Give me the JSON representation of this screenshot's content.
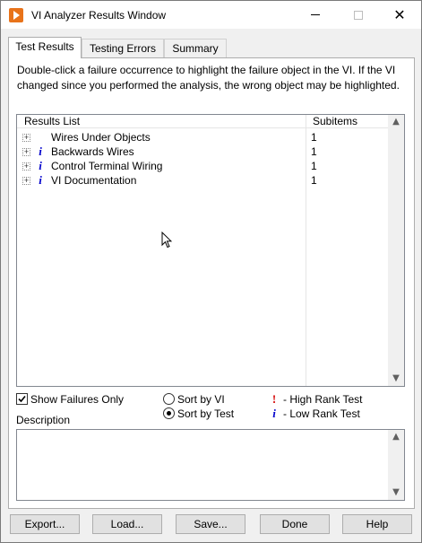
{
  "window": {
    "title": "VI Analyzer Results Window",
    "icon": "labview-icon",
    "controls": {
      "minimize": "minimize-icon",
      "maximize": "maximize-icon",
      "close": "close-icon"
    }
  },
  "tabs": [
    {
      "label": "Test Results",
      "active": true
    },
    {
      "label": "Testing Errors",
      "active": false
    },
    {
      "label": "Summary",
      "active": false
    }
  ],
  "instructions": "Double-click a failure occurrence to highlight the failure object in the VI.  If the VI changed since you performed the analysis, the wrong object may be highlighted.",
  "results": {
    "columns": [
      "Results List",
      "Subitems"
    ],
    "rows": [
      {
        "label": "Wires Under Objects",
        "subitems": "1",
        "rank": ""
      },
      {
        "label": "Backwards Wires",
        "subitems": "1",
        "rank": "i"
      },
      {
        "label": "Control Terminal Wiring",
        "subitems": "1",
        "rank": "i"
      },
      {
        "label": "VI Documentation",
        "subitems": "1",
        "rank": "i"
      }
    ]
  },
  "options": {
    "show_failures_only": {
      "label": "Show Failures Only",
      "checked": true
    },
    "sort": [
      {
        "label": "Sort by VI",
        "selected": false
      },
      {
        "label": "Sort by Test",
        "selected": true
      }
    ],
    "legend": [
      {
        "symbol": "!",
        "label": "- High Rank Test",
        "color": "#d40000"
      },
      {
        "symbol": "i",
        "label": "- Low Rank Test",
        "color": "#0000cc"
      }
    ]
  },
  "description": {
    "label": "Description",
    "value": ""
  },
  "buttons": [
    "Export...",
    "Load...",
    "Save...",
    "Done",
    "Help"
  ]
}
